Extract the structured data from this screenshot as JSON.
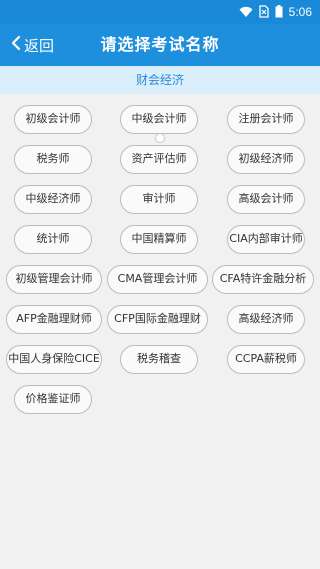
{
  "status_bar": {
    "time": "5:06",
    "icons": [
      "wifi-icon",
      "no-sim-icon",
      "battery-icon"
    ]
  },
  "nav": {
    "back_label": "返回",
    "title": "请选择考试名称"
  },
  "category": "财会经济",
  "colors": {
    "primary": "#1e8fdd",
    "status_bar": "#1a8ad8",
    "category_bg": "#dbeefb",
    "category_text": "#2d8ad8"
  },
  "exams": [
    "初级会计师",
    "中级会计师",
    "注册会计师",
    "税务师",
    "资产评估师",
    "初级经济师",
    "中级经济师",
    "审计师",
    "高级会计师",
    "统计师",
    "中国精算师",
    "CIA内部审计师",
    "初级管理会计师",
    "CMA管理会计师",
    "CFA特许金融分析",
    "AFP金融理财师",
    "CFP国际金融理财",
    "高级经济师",
    "中国人身保险CICE",
    "税务稽查",
    "CCPA薪税师",
    "价格鉴证师"
  ]
}
